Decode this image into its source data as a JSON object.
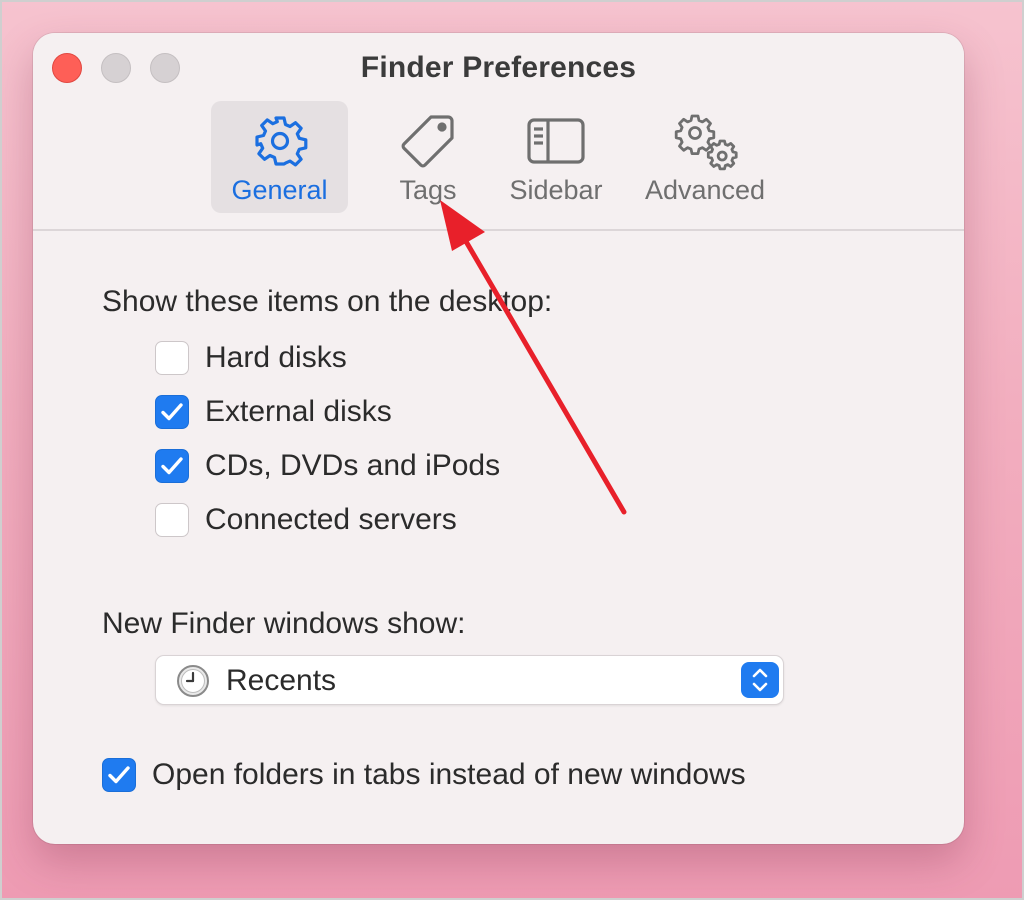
{
  "window": {
    "title": "Finder Preferences"
  },
  "tabs": [
    {
      "label": "General",
      "icon": "gear-icon",
      "active": true
    },
    {
      "label": "Tags",
      "icon": "tag-icon",
      "active": false
    },
    {
      "label": "Sidebar",
      "icon": "sidebar-icon",
      "active": false
    },
    {
      "label": "Advanced",
      "icon": "gears-icon",
      "active": false
    }
  ],
  "desktop": {
    "heading": "Show these items on the desktop:",
    "items": [
      {
        "label": "Hard disks",
        "checked": false
      },
      {
        "label": "External disks",
        "checked": true
      },
      {
        "label": "CDs, DVDs and iPods",
        "checked": true
      },
      {
        "label": "Connected servers",
        "checked": false
      }
    ]
  },
  "new_window": {
    "heading": "New Finder windows show:",
    "selected": "Recents",
    "icon": "clock-icon"
  },
  "open_in_tabs": {
    "label": "Open folders in tabs instead of new windows",
    "checked": true
  },
  "colors": {
    "accent": "#1f7bf0",
    "close": "#fe5f57",
    "annotation_arrow": "#e8202a"
  }
}
